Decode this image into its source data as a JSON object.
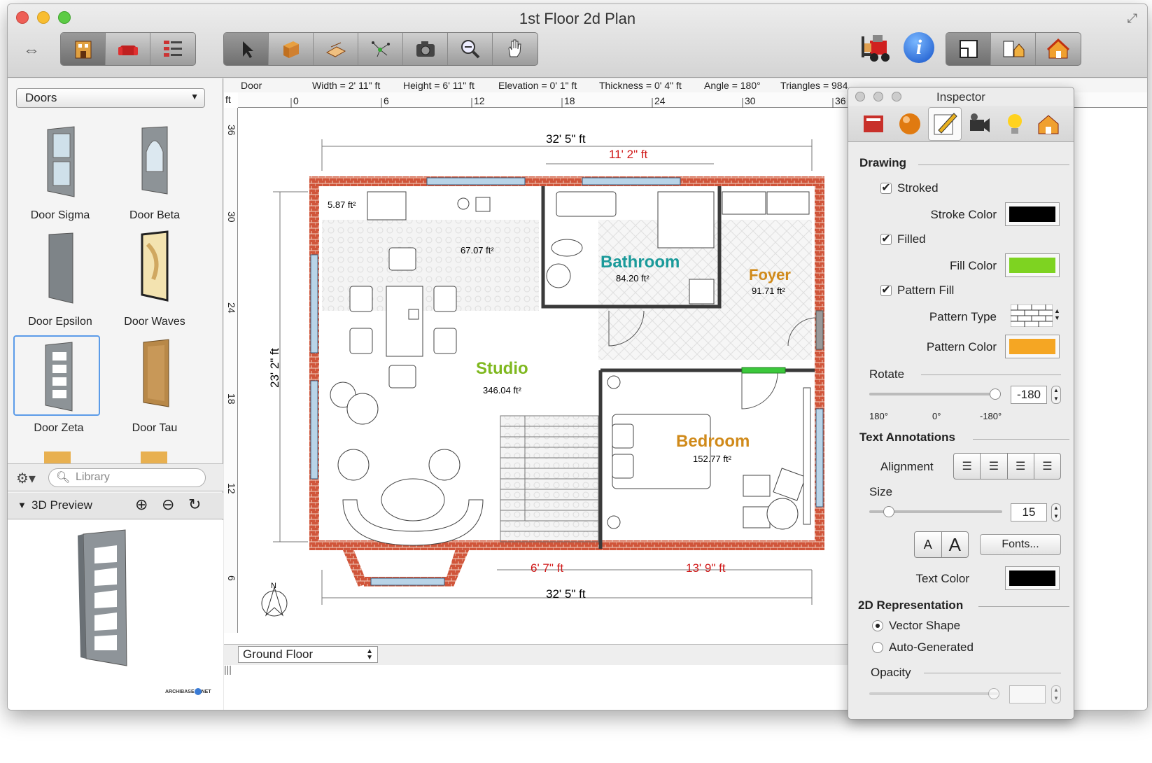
{
  "window": {
    "title": "1st Floor 2d Plan"
  },
  "sidebar": {
    "category": "Doors",
    "items": [
      {
        "label": "Door Sigma"
      },
      {
        "label": "Door Beta"
      },
      {
        "label": "Door Epsilon"
      },
      {
        "label": "Door Waves"
      },
      {
        "label": "Door Zeta",
        "selected": true
      },
      {
        "label": "Door Tau"
      }
    ],
    "search_placeholder": "Library",
    "preview_title": "3D Preview",
    "watermark": "ARCHIBASE NET"
  },
  "infobar": {
    "object": "Door",
    "width": "Width = 2' 11\" ft",
    "height": "Height = 6' 11\" ft",
    "elevation": "Elevation = 0' 1\" ft",
    "thickness": "Thickness = 0' 4\" ft",
    "angle": "Angle = 180°",
    "triangles": "Triangles = 984"
  },
  "ruler": {
    "unit": "ft",
    "h_ticks": [
      "0",
      "6",
      "12",
      "18",
      "24",
      "30",
      "36"
    ],
    "v_ticks": [
      "36",
      "30",
      "24",
      "18",
      "12",
      "6"
    ]
  },
  "plan": {
    "dim_top": "32' 5\" ft",
    "dim_top_red": "11' 2\" ft",
    "dim_left": "23' 2\" ft",
    "dim_bottom": "32' 5\" ft",
    "dim_bottom_red1": "6' 7\" ft",
    "dim_bottom_red2": "13' 9\" ft",
    "compass": "N",
    "rooms": [
      {
        "name": "",
        "area": "5.87 ft²"
      },
      {
        "name": "",
        "area": "67.07 ft²"
      },
      {
        "name": "Bathroom",
        "area": "84.20 ft²",
        "color": "#1a9a9a"
      },
      {
        "name": "Foyer",
        "area": "91.71 ft²",
        "color": "#d08a1a"
      },
      {
        "name": "Studio",
        "area": "346.04 ft²",
        "color": "#7fb81f"
      },
      {
        "name": "Bedroom",
        "area": "152.77 ft²",
        "color": "#d08a1a"
      }
    ]
  },
  "floor_selector": "Ground Floor",
  "inspector": {
    "title": "Inspector",
    "drawing": {
      "header": "Drawing",
      "stroked": "Stroked",
      "stroke_color_label": "Stroke Color",
      "stroke_color": "#000000",
      "filled": "Filled",
      "fill_color_label": "Fill Color",
      "fill_color": "#7ed321",
      "pattern_fill": "Pattern Fill",
      "pattern_type_label": "Pattern Type",
      "pattern_color_label": "Pattern Color",
      "pattern_color": "#f5a623"
    },
    "rotate": {
      "label": "Rotate",
      "value": "-180",
      "ticks": [
        "180°",
        "0°",
        "-180°"
      ]
    },
    "text_annotations": {
      "header": "Text Annotations",
      "alignment_label": "Alignment",
      "size_label": "Size",
      "size_value": "15",
      "font_small": "A",
      "font_large": "A",
      "fonts_button": "Fonts...",
      "text_color_label": "Text Color",
      "text_color": "#000000"
    },
    "representation": {
      "header": "2D Representation",
      "vector": "Vector Shape",
      "auto": "Auto-Generated",
      "selected": "Vector Shape"
    },
    "opacity": {
      "label": "Opacity",
      "value": ""
    }
  }
}
